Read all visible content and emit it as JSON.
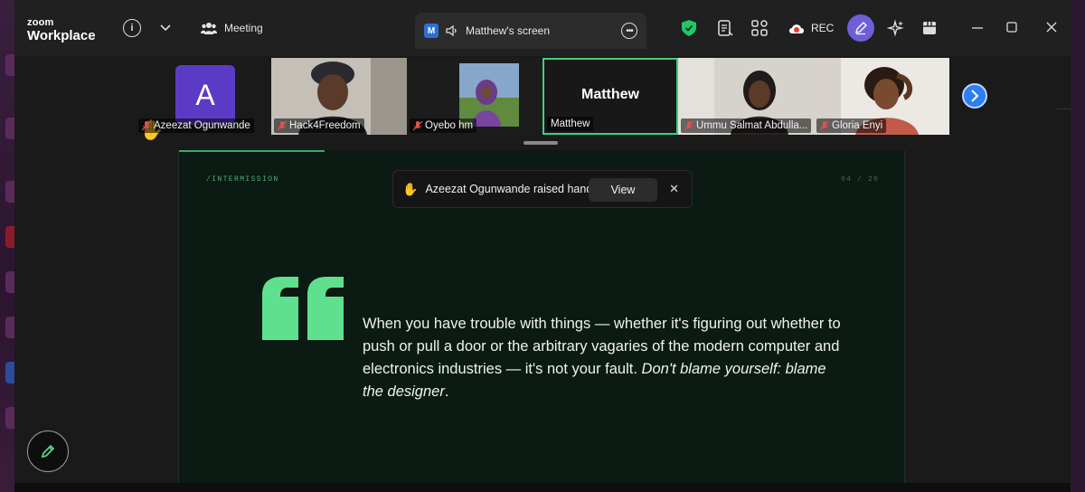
{
  "app": {
    "logo_line1": "zoom",
    "logo_line2": "Workplace"
  },
  "titlebar": {
    "info_icon": "info-icon",
    "chevron_icon": "chevron-down-icon",
    "meeting_label": "Meeting",
    "screen_tab": {
      "badge": "M",
      "label": "Matthew's screen",
      "more_icon": "more-icon"
    },
    "rec_label": "REC",
    "icons": [
      "shield-icon",
      "notes-icon",
      "apps-icon",
      "rec-cloud-icon",
      "annotate-avatar-icon",
      "ai-companion-icon",
      "layout-icon",
      "minimize-icon",
      "maximize-icon",
      "close-icon"
    ],
    "colors": {
      "shield": "#1ec96a",
      "avatar": "#6e5fd8",
      "rec_dot": "#e53935"
    }
  },
  "participants": [
    {
      "name": "Azeezat Ogunwande",
      "avatar_letter": "A",
      "muted": true,
      "hand_raised": true
    },
    {
      "name": "Hack4Freedom",
      "muted": true
    },
    {
      "name": "Oyebo hm",
      "muted": true
    },
    {
      "name": "Matthew",
      "display_name": "Matthew",
      "active_speaker": true
    },
    {
      "name": "Ummu Salmat Abdulla...",
      "muted": true
    },
    {
      "name": "Gloria Enyi",
      "muted": true
    }
  ],
  "slide": {
    "section": "/INTERMISSION",
    "page": "04 / 20",
    "quote_main": "When you have trouble with things — whether it's figuring out whether to push or pull a door or the arbitrary vagaries of the modern computer and electronics industries — it's not your fault.",
    "quote_emphasis": "Don't blame yourself: blame the designer",
    "quote_end": ".",
    "accent": "#5fe08e"
  },
  "toast": {
    "message": "Azeezat Ogunwande raised hand",
    "view_label": "View",
    "close_icon": "close-icon"
  },
  "annotate": {
    "icon": "pencil-icon"
  }
}
